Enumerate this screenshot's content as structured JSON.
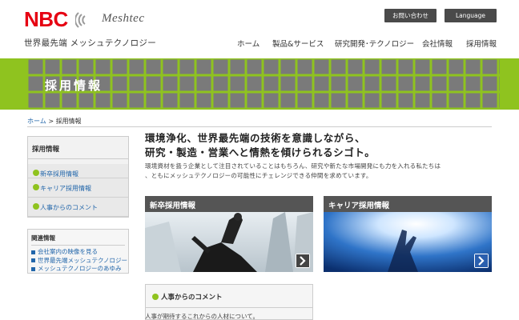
{
  "header": {
    "logo_text": "NBC",
    "logo_sub": "Meshtec",
    "tagline": "世界最先端 メッシュテクノロジー",
    "contact_label": "お問い合わせ",
    "language_label": "Language",
    "nav": [
      "ホーム",
      "製品&サービス",
      "研究開発･テクノロジー",
      "会社情報",
      "採用情報"
    ]
  },
  "banner": {
    "title": "採用情報"
  },
  "breadcrumb": {
    "home": "ホーム",
    "separator": ">",
    "current": "採用情報"
  },
  "sidebar": {
    "heading": "採用情報",
    "items": [
      {
        "label": "新卒採用情報"
      },
      {
        "label": "キャリア採用情報"
      },
      {
        "label": "人事からのコメント"
      }
    ]
  },
  "related": {
    "heading": "関連情報",
    "items": [
      {
        "label": "会社案内の映像を見る"
      },
      {
        "label": "世界最先端メッシュテクノロジー"
      },
      {
        "label": "メッシュテクノロジーのあゆみ"
      }
    ]
  },
  "main": {
    "headline_1": "環境浄化、世界最先端の技術を意識しながら、",
    "headline_2": "研究・製造・営業へと情熱を傾けられるシゴト。",
    "intro_1": "環境資材を扱う企業として注目されていることはもちろん、研究や新たな市場開発にも力を入れる私たちは",
    "intro_2": "、ともにメッシュテクノロジーの可能性にチェレンジできる仲間を求めています。",
    "card_new_label": "新卒採用情報",
    "card_career_label": "キャリア採用情報",
    "comment_heading": "人事からのコメント",
    "comment_text": "人事が期待するこれからの人材について。"
  },
  "colors": {
    "accent_green": "#8fc31f",
    "brand_red": "#e60012",
    "link_blue": "#2266aa",
    "bar_gray": "#555555"
  },
  "icons": {
    "arrow": "arrow-right-icon",
    "bullet": "bullet-icon"
  }
}
